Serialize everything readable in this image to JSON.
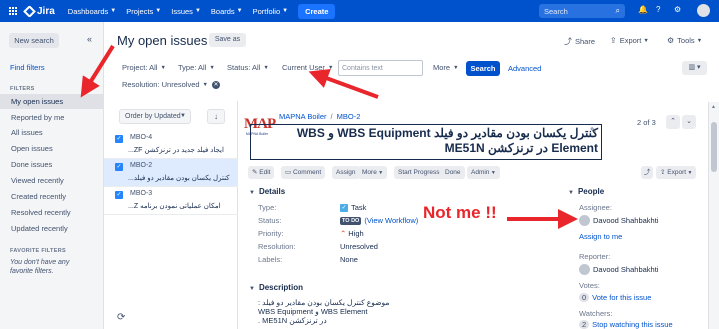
{
  "topnav": {
    "logo": "Jira",
    "items": [
      "Dashboards",
      "Projects",
      "Issues",
      "Boards",
      "Portfolio"
    ],
    "create": "Create",
    "search_placeholder": "Search"
  },
  "sidebar": {
    "new_search": "New search",
    "find_filters": "Find filters",
    "filters_heading": "FILTERS",
    "filters": [
      "My open issues",
      "Reported by me",
      "All issues",
      "Open issues",
      "Done issues",
      "Viewed recently",
      "Created recently",
      "Resolved recently",
      "Updated recently"
    ],
    "favorites_heading": "FAVORITE FILTERS",
    "no_favorites": "You don't have any favorite filters."
  },
  "header": {
    "title": "My open issues",
    "save_as": "Save as",
    "share": "Share",
    "export": "Export",
    "tools": "Tools"
  },
  "filterbar": {
    "project": "Project: All",
    "type": "Type: All",
    "status": "Status: All",
    "assignee": "Current User",
    "contains_placeholder": "Contains text",
    "more": "More",
    "search": "Search",
    "advanced": "Advanced",
    "resolution": "Resolution: Unresolved"
  },
  "list": {
    "order_by": "Order by Updated",
    "issues": [
      {
        "key": "MBO-4",
        "summary": "ایجاد فیلد جدید در ترنزکشن ZF..."
      },
      {
        "key": "MBO-2",
        "summary": "کنترل یکسان بودن مقادیر دو فیلد..."
      },
      {
        "key": "MBO-3",
        "summary": "امکان عملیاتی نمودن برنامه Z..."
      }
    ]
  },
  "issue": {
    "project": "MAPNA Boiler",
    "key": "MBO-2",
    "logo_text": "MAP",
    "logo_sub": "MAPNA Boiler",
    "summary": "کنترل یکسان بودن مقادیر دو فیلد WBS Equipment و WBS Element در ترنزکشن ME51N",
    "pager": "2 of 3",
    "actions": [
      "Edit",
      "Comment",
      "Assign",
      "More",
      "Start Progress",
      "Done",
      "Admin"
    ],
    "export": "Export",
    "details_heading": "Details",
    "fields": [
      {
        "label": "Type:",
        "value": "Task"
      },
      {
        "label": "Status:",
        "value": "TO DO",
        "extra": "(View Workflow)"
      },
      {
        "label": "Priority:",
        "value": "High"
      },
      {
        "label": "Resolution:",
        "value": "Unresolved"
      },
      {
        "label": "Labels:",
        "value": "None"
      }
    ],
    "description_heading": "Description",
    "description": [
      "موضوع کنترل یکسان بودن مقادیر دو فیلد :",
      "WBS Equipment و WBS Element",
      "در ترنزکشن ME51N ."
    ]
  },
  "people": {
    "heading": "People",
    "assignee_label": "Assignee:",
    "assignee": "Davood Shahbakhti",
    "assign_to_me": "Assign to me",
    "reporter_label": "Reporter:",
    "reporter": "Davood Shahbakhti",
    "votes_label": "Votes:",
    "votes_count": "0",
    "vote_link": "Vote for this issue",
    "watchers_label": "Watchers:",
    "watchers_count": "2",
    "watch_link": "Stop watching this issue"
  },
  "annotation": {
    "text": "Not me !!",
    "color": "#e8262b"
  }
}
